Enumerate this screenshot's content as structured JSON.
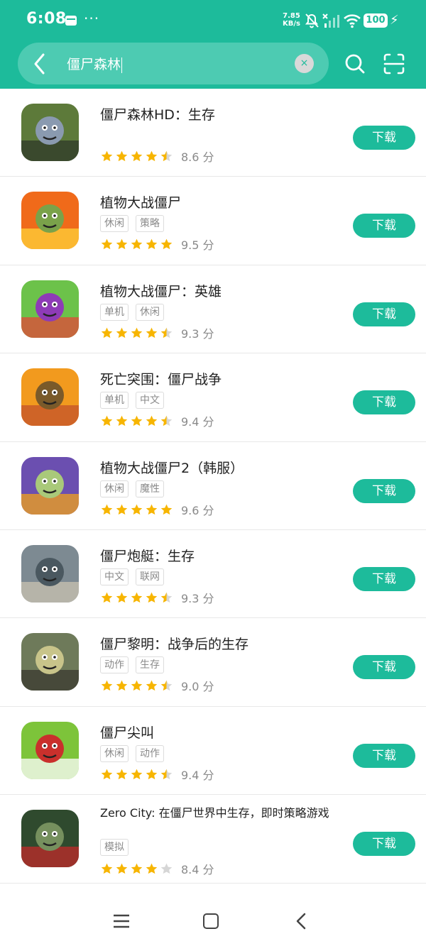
{
  "status_bar": {
    "time": "6:08",
    "net_speed_value": "7.85",
    "net_speed_unit": "KB/s",
    "battery": "100"
  },
  "search": {
    "query": "僵尸森林",
    "clear_symbol": "×"
  },
  "apps": [
    {
      "title": "僵尸森林HD：生存",
      "tags": [],
      "score": "8.6 分",
      "stars": 4.5,
      "button": "下载",
      "icon_name": "zombie-forest-hd-icon",
      "icon_colors": [
        "#5d7a3a",
        "#8a9ab0",
        "#2f3a2a"
      ]
    },
    {
      "title": "植物大战僵尸",
      "tags": [
        "休闲",
        "策略"
      ],
      "score": "9.5 分",
      "stars": 5,
      "button": "下载",
      "icon_name": "plants-vs-zombies-icon",
      "icon_colors": [
        "#f06a1a",
        "#7aa24a",
        "#ffd33a"
      ]
    },
    {
      "title": "植物大战僵尸：英雄",
      "tags": [
        "单机",
        "休闲"
      ],
      "score": "9.3 分",
      "stars": 4.5,
      "button": "下载",
      "icon_name": "pvz-heroes-icon",
      "icon_colors": [
        "#6cc24a",
        "#8e3bb7",
        "#e3473a"
      ]
    },
    {
      "title": "死亡突围：僵尸战争",
      "tags": [
        "单机",
        "中文"
      ],
      "score": "9.4 分",
      "stars": 4.5,
      "button": "下载",
      "icon_name": "into-the-dead-war-icon",
      "icon_colors": [
        "#f29a1e",
        "#7a5a2a",
        "#c3512b"
      ]
    },
    {
      "title": "植物大战僵尸2（韩服）",
      "tags": [
        "休闲",
        "魔性"
      ],
      "score": "9.6 分",
      "stars": 5,
      "button": "下载",
      "icon_name": "pvz2-korea-icon",
      "icon_colors": [
        "#6b4fb0",
        "#a9c97a",
        "#f2a21a"
      ]
    },
    {
      "title": "僵尸炮艇：生存",
      "tags": [
        "中文",
        "联网"
      ],
      "score": "9.3 分",
      "stars": 4.5,
      "button": "下载",
      "icon_name": "zombie-gunship-icon",
      "icon_colors": [
        "#7d8a92",
        "#4a5860",
        "#c9c2b0"
      ]
    },
    {
      "title": "僵尸黎明：战争后的生存",
      "tags": [
        "动作",
        "生存"
      ],
      "score": "9.0 分",
      "stars": 4.5,
      "button": "下载",
      "icon_name": "zombie-dawn-icon",
      "icon_colors": [
        "#6e7a5a",
        "#c8c48a",
        "#3b3a30"
      ]
    },
    {
      "title": "僵尸尖叫",
      "tags": [
        "休闲",
        "动作"
      ],
      "score": "9.4 分",
      "stars": 4.5,
      "button": "下载",
      "icon_name": "zombie-scream-icon",
      "icon_colors": [
        "#7dc43a",
        "#c9302c",
        "#ffffff"
      ]
    },
    {
      "title": "Zero City: 在僵尸世界中生存，即时策略游戏",
      "tags": [
        "模拟"
      ],
      "score": "8.4 分",
      "stars": 4,
      "button": "下载",
      "icon_name": "zero-city-icon",
      "icon_colors": [
        "#2f4a2e",
        "#76905e",
        "#c22a2a"
      ]
    }
  ],
  "colors": {
    "accent": "#1dbb9b",
    "star_filled": "#f7b500",
    "star_empty": "#d6d6d6"
  }
}
